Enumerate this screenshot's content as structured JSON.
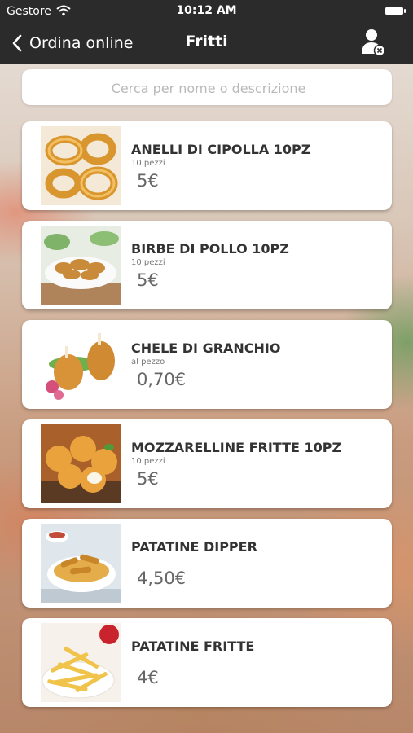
{
  "status": {
    "carrier": "Gestore",
    "time": "10:12 AM"
  },
  "nav": {
    "back_label": "Ordina online",
    "title": "Fritti"
  },
  "search": {
    "placeholder": "Cerca per nome o descrizione",
    "value": ""
  },
  "items": [
    {
      "name": "ANELLI DI CIPOLLA 10PZ",
      "subtitle": "10 pezzi",
      "price": "5€"
    },
    {
      "name": "BIRBE DI POLLO 10PZ",
      "subtitle": "10 pezzi",
      "price": "5€"
    },
    {
      "name": "CHELE DI GRANCHIO",
      "subtitle": "al pezzo",
      "price": "0,70€"
    },
    {
      "name": "MOZZARELLINE FRITTE 10PZ",
      "subtitle": "10 pezzi",
      "price": "5€"
    },
    {
      "name": "PATATINE DIPPER",
      "subtitle": "",
      "price": "4,50€"
    },
    {
      "name": "PATATINE FRITTE",
      "subtitle": "",
      "price": "4€"
    }
  ],
  "icons": {
    "back": "chevron-left-icon",
    "user": "user-remove-icon",
    "wifi": "wifi-icon",
    "battery": "battery-icon"
  },
  "colors": {
    "bar": "#2b2b2b",
    "card": "#ffffff",
    "text": "#333333",
    "price": "#666666"
  }
}
